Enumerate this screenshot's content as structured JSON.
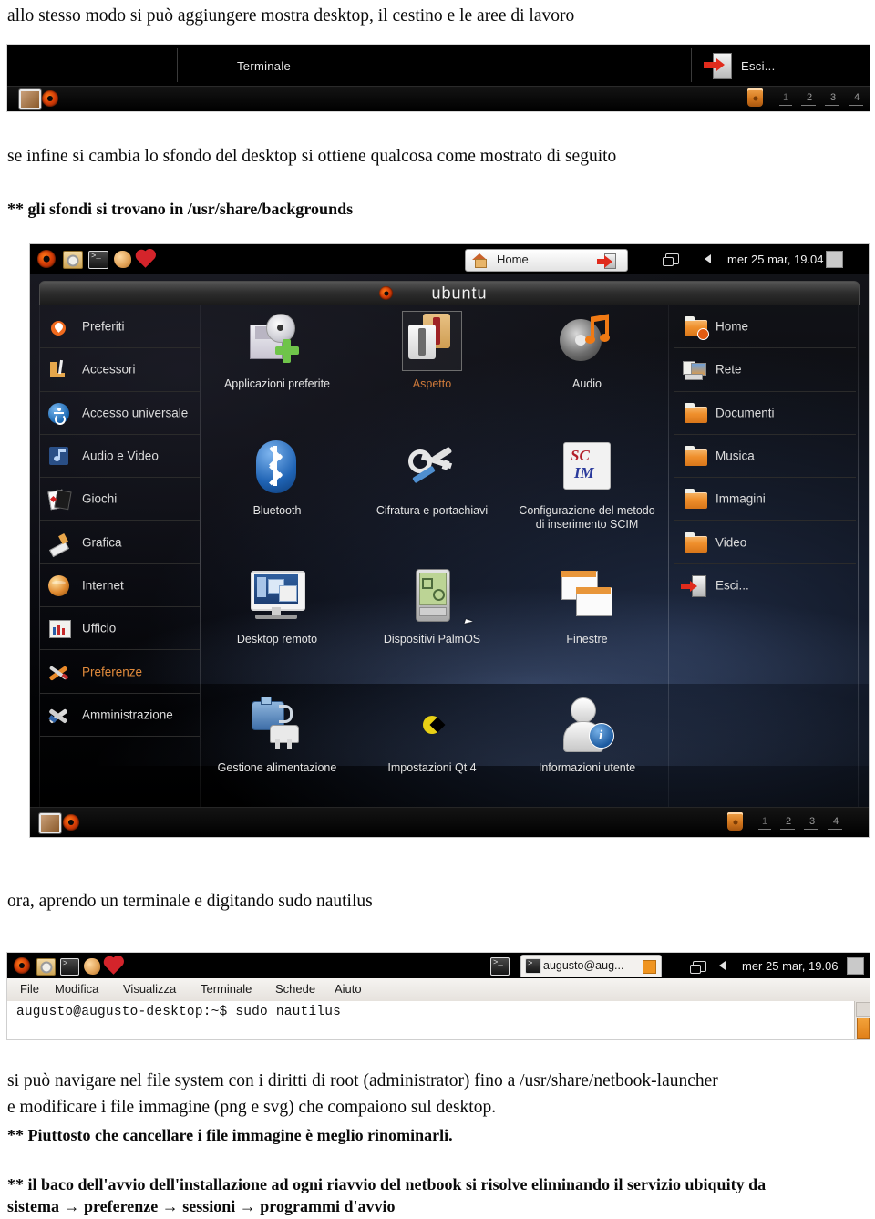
{
  "document": {
    "paragraphs": {
      "p1": "allo stesso modo si può aggiungere mostra desktop, il cestino e le aree di lavoro",
      "p2": "se infine si cambia lo sfondo del desktop si ottiene qualcosa come mostrato di seguito",
      "p3": "** gli sfondi si trovano in /usr/share/backgrounds",
      "p4": "ora, aprendo un terminale e digitando sudo nautilus",
      "p5_line1": "si può navigare nel file system con i diritti di root (administrator) fino a /usr/share/netbook-launcher",
      "p5_line2": "e modificare i file immagine (png e svg) che compaiono sul desktop.",
      "p6": "** Piuttosto che cancellare i file immagine è meglio rinominarli.",
      "p7_line1": "** il baco dell'avvio dell'installazione ad ogni riavvio del netbook si risolve eliminando il servizio ubiquity da",
      "p7_line2": "sistema → preferenze → sessioni → programmi d'avvio"
    }
  },
  "shot_panel": {
    "window_title": "Terminale",
    "logout_label": "Esci...",
    "workspaces": [
      "1",
      "2",
      "3",
      "4"
    ],
    "icons": {
      "show_desktop": "show-desktop-icon",
      "ubuntu": "ubuntu-logo-icon",
      "trash": "trash-icon",
      "logout": "logout-door-icon"
    }
  },
  "shot_launcher": {
    "brand": "ubuntu",
    "top_panel": {
      "home_button": "Home",
      "clock": "mer 25 mar, 19.04",
      "launcher_icons": [
        "ubuntu-logo-icon",
        "update-manager-icon",
        "terminal-icon",
        "shell-icon",
        "heart-icon"
      ],
      "tray_icons": [
        "window-switcher-icon",
        "volume-icon",
        "keyboard-indicator-icon"
      ]
    },
    "categories": [
      {
        "label": "Preferiti",
        "icon": "heart-icon",
        "selected": false
      },
      {
        "label": "Accessori",
        "icon": "accessories-icon",
        "selected": false
      },
      {
        "label": "Accesso universale",
        "icon": "accessibility-icon",
        "selected": false
      },
      {
        "label": "Audio e Video",
        "icon": "music-note-icon",
        "selected": false
      },
      {
        "label": "Giochi",
        "icon": "cards-icon",
        "selected": false
      },
      {
        "label": "Grafica",
        "icon": "graphics-icon",
        "selected": false
      },
      {
        "label": "Internet",
        "icon": "globe-icon",
        "selected": false
      },
      {
        "label": "Ufficio",
        "icon": "office-icon",
        "selected": false
      },
      {
        "label": "Preferenze",
        "icon": "tools-icon",
        "selected": true
      },
      {
        "label": "Amministrazione",
        "icon": "wrench-icon",
        "selected": false
      }
    ],
    "apps": [
      {
        "label": "Applicazioni preferite",
        "icon": "preferred-applications-icon",
        "hover": false
      },
      {
        "label": "Aspetto",
        "icon": "appearance-shirts-icon",
        "hover": true
      },
      {
        "label": "Audio",
        "icon": "audio-cd-note-icon",
        "hover": false
      },
      {
        "label": "Bluetooth",
        "icon": "bluetooth-icon",
        "hover": false
      },
      {
        "label": "Cifratura e portachiavi",
        "icon": "keyring-icon",
        "hover": false
      },
      {
        "label": "Configurazione del metodo di inserimento SCIM",
        "icon": "scim-icon",
        "hover": false
      },
      {
        "label": "Desktop remoto",
        "icon": "remote-desktop-icon",
        "hover": false
      },
      {
        "label": "Dispositivi PalmOS",
        "icon": "palmos-icon",
        "hover": false
      },
      {
        "label": "Finestre",
        "icon": "windows-icon",
        "hover": false
      },
      {
        "label": "Gestione alimentazione",
        "icon": "power-management-icon",
        "hover": false
      },
      {
        "label": "Impostazioni Qt 4",
        "icon": "qt4-icon",
        "hover": false
      },
      {
        "label": "Informazioni utente",
        "icon": "user-info-icon",
        "hover": false
      }
    ],
    "places": [
      {
        "label": "Home",
        "icon": "home-folder-icon"
      },
      {
        "label": "Rete",
        "icon": "network-icon"
      },
      {
        "label": "Documenti",
        "icon": "folder-icon"
      },
      {
        "label": "Musica",
        "icon": "folder-icon"
      },
      {
        "label": "Immagini",
        "icon": "folder-icon"
      },
      {
        "label": "Video",
        "icon": "folder-icon"
      },
      {
        "label": "Esci...",
        "icon": "logout-door-icon"
      }
    ],
    "bottom_panel": {
      "workspaces": [
        "1",
        "2",
        "3",
        "4"
      ],
      "icons": [
        "show-desktop-icon",
        "ubuntu-logo-icon",
        "trash-icon"
      ]
    }
  },
  "shot_terminal": {
    "top_panel": {
      "launcher_icons": [
        "ubuntu-logo-icon",
        "update-manager-icon",
        "terminal-icon",
        "shell-icon",
        "heart-icon"
      ],
      "task_label": "augusto@aug...",
      "clock": "mer 25 mar, 19.06"
    },
    "menu": [
      "File",
      "Modifica",
      "Visualizza",
      "Terminale",
      "Schede",
      "Aiuto"
    ],
    "command_line": "augusto@augusto-desktop:~$ sudo nautilus"
  },
  "colors": {
    "accent_orange": "#e08a3c",
    "panel_black": "#000000",
    "terminal_bg": "#ffffff",
    "selection_orange": "#cf7a3a"
  }
}
